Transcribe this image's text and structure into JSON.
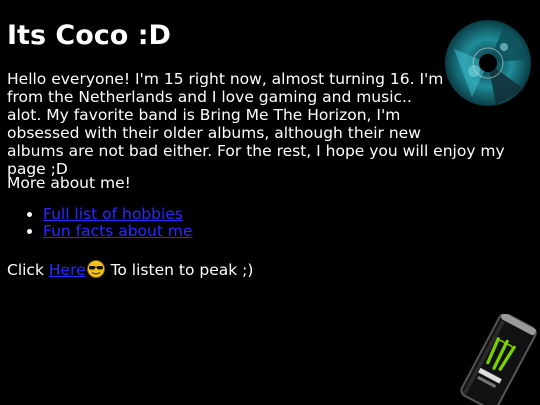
{
  "header": {
    "title": "Its Coco :D"
  },
  "intro": {
    "text": "Hello everyone! I'm 15 right now, almost turning 16. I'm from the Netherlands and I love gaming and music.. alot. My favorite band is Bring Me The Horizon, I'm obsessed with their older albums, although their new albums are not bad either. For the rest, I hope you will enjoy my page ;D"
  },
  "more": {
    "heading": "More about me!"
  },
  "links": [
    {
      "label": "Full list of hobbies"
    },
    {
      "label": "Fun facts about me"
    }
  ],
  "listen": {
    "prefix": "Click ",
    "link_label": "Here",
    "suffix": " To listen to peak ;)"
  },
  "colors": {
    "background": "#000000",
    "text": "#ffffff",
    "link": "#2a2aff",
    "accent_green": "#7ad000",
    "cd_teal": "#1f8c99"
  },
  "images": {
    "cd": "album-cd-image",
    "smiley": "sunglasses-smiley-icon",
    "can": "energy-drink-can-image"
  }
}
